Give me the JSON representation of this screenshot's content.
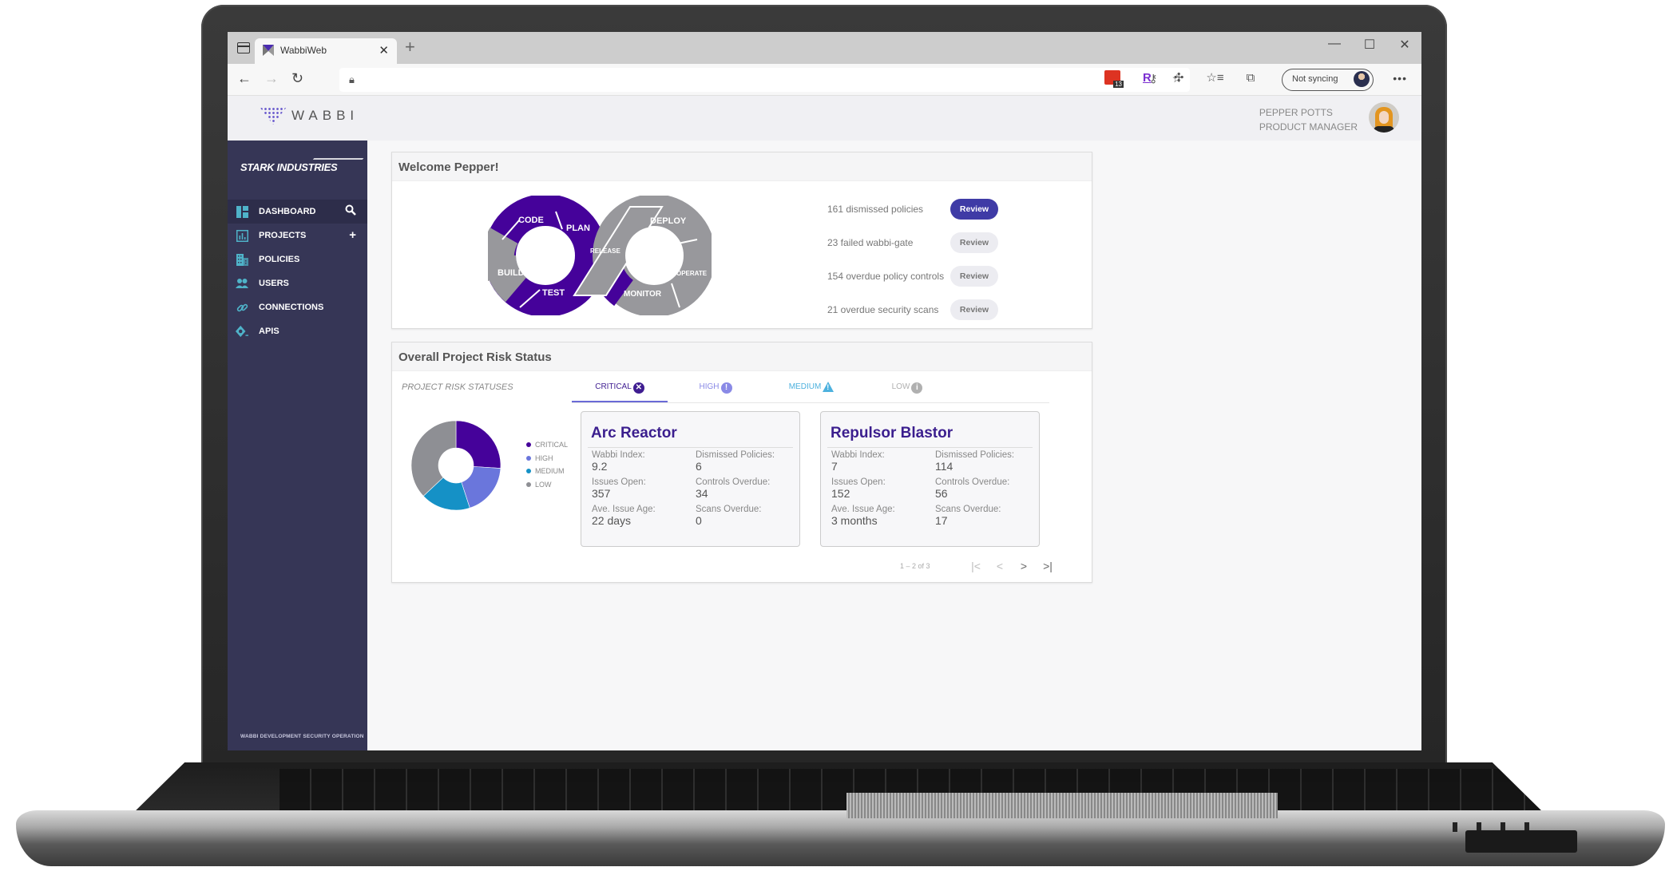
{
  "browser": {
    "tab_title": "WabbiWeb",
    "sync_label": "Not syncing",
    "extension_badge": "13",
    "extension_letter": "R",
    "window_controls": [
      "—",
      "☐",
      "✕"
    ]
  },
  "app": {
    "logo_text": "WABBI",
    "user": {
      "name": "PEPPER POTTS",
      "role": "PRODUCT MANAGER"
    }
  },
  "sidebar": {
    "brand": "STARK INDUSTRIES",
    "items": [
      {
        "label": "DASHBOARD",
        "icon": "dashboard-icon",
        "action": "search-icon",
        "active": true
      },
      {
        "label": "PROJECTS",
        "icon": "chart-icon",
        "action": "plus-icon",
        "active": false
      },
      {
        "label": "POLICIES",
        "icon": "building-icon",
        "active": false
      },
      {
        "label": "USERS",
        "icon": "users-icon",
        "active": false
      },
      {
        "label": "CONNECTIONS",
        "icon": "link-icon",
        "active": false
      },
      {
        "label": "APIS",
        "icon": "api-icon",
        "active": false
      }
    ],
    "footer": "WABBI DEVELOPMENT SECURITY OPERATION"
  },
  "welcome": {
    "title": "Welcome Pepper!",
    "devops_stages": [
      "CODE",
      "PLAN",
      "BUILD",
      "TEST",
      "RELEASE",
      "DEPLOY",
      "OPERATE",
      "MONITOR"
    ],
    "actions": [
      {
        "text": "161 dismissed policies",
        "button": "Review",
        "primary": true
      },
      {
        "text": "23 failed wabbi-gate",
        "button": "Review",
        "primary": false
      },
      {
        "text": "154 overdue policy controls",
        "button": "Review",
        "primary": false
      },
      {
        "text": "21 overdue security scans",
        "button": "Review",
        "primary": false
      }
    ]
  },
  "risk": {
    "title": "Overall Project Risk Status",
    "subtitle": "PROJECT RISK STATUSES",
    "tabs": [
      {
        "label": "CRITICAL",
        "color": "#3f1d91",
        "icon": "x-circle-icon",
        "active": true
      },
      {
        "label": "HIGH",
        "color": "#8a8ae6",
        "icon": "exclamation-circle-icon",
        "active": false
      },
      {
        "label": "MEDIUM",
        "color": "#4db1de",
        "icon": "warning-triangle-icon",
        "active": false
      },
      {
        "label": "LOW",
        "color": "#b0b0b0",
        "icon": "info-circle-icon",
        "active": false
      }
    ],
    "projects": [
      {
        "name": "Arc Reactor",
        "stats": [
          {
            "label": "Wabbi Index:",
            "value": "9.2"
          },
          {
            "label": "Dismissed Policies:",
            "value": "6"
          },
          {
            "label": "Issues Open:",
            "value": "357"
          },
          {
            "label": "Controls Overdue:",
            "value": "34"
          },
          {
            "label": "Ave. Issue Age:",
            "value": "22 days"
          },
          {
            "label": "Scans Overdue:",
            "value": "0"
          }
        ]
      },
      {
        "name": "Repulsor Blastor",
        "stats": [
          {
            "label": "Wabbi Index:",
            "value": "7"
          },
          {
            "label": "Dismissed Policies:",
            "value": "114"
          },
          {
            "label": "Issues Open:",
            "value": "152"
          },
          {
            "label": "Controls Overdue:",
            "value": "56"
          },
          {
            "label": "Ave. Issue Age:",
            "value": "3 months"
          },
          {
            "label": "Scans Overdue:",
            "value": "17"
          }
        ]
      }
    ],
    "pagination": "1 – 2 of 3"
  },
  "chart_data": {
    "type": "pie",
    "title": "",
    "categories": [
      "CRITICAL",
      "HIGH",
      "MEDIUM",
      "LOW"
    ],
    "values": [
      26,
      19,
      18,
      37
    ],
    "colors": [
      "#45029a",
      "#6a76dc",
      "#1591c6",
      "#8e8f94"
    ],
    "legend": "right"
  }
}
